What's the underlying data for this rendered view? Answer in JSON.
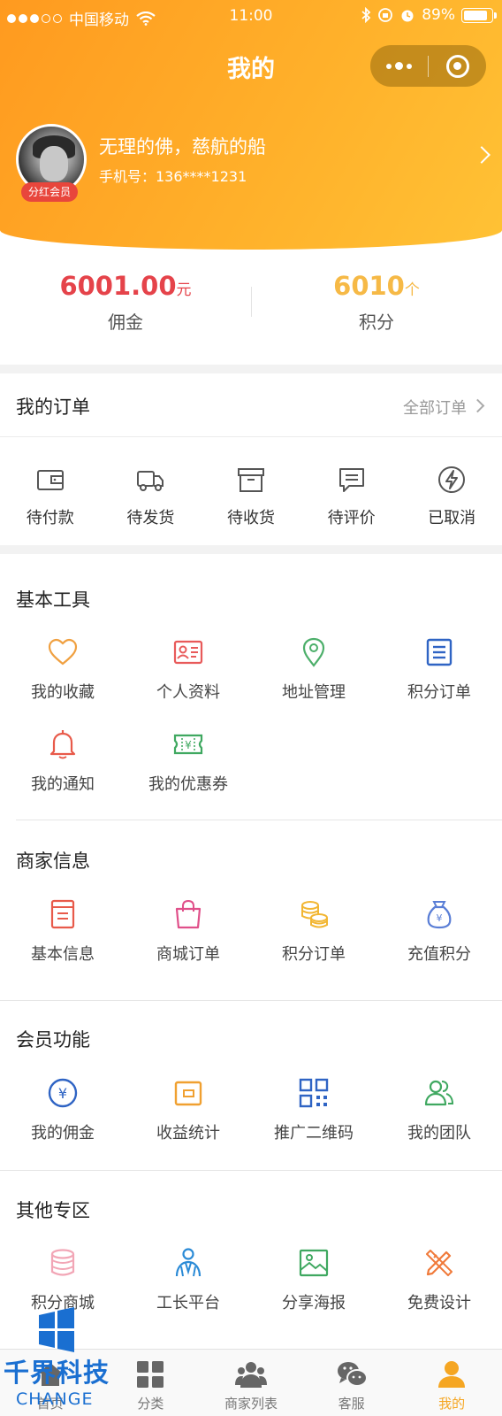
{
  "status_bar": {
    "carrier": "中国移动",
    "time": "11:00",
    "battery": "89%"
  },
  "nav": {
    "title": "我的"
  },
  "profile": {
    "name": "无理的佛，慈航的船",
    "phone": "手机号：136****1231",
    "badge": "分红会员"
  },
  "stats": {
    "commission": {
      "value": "6001.00",
      "unit": "元",
      "label": "佣金"
    },
    "points": {
      "value": "6010",
      "unit": "个",
      "label": "积分"
    }
  },
  "orders": {
    "title": "我的订单",
    "all_label": "全部订单",
    "items": [
      {
        "label": "待付款",
        "icon": "wallet-icon"
      },
      {
        "label": "待发货",
        "icon": "truck-icon"
      },
      {
        "label": "待收货",
        "icon": "box-icon"
      },
      {
        "label": "待评价",
        "icon": "comment-icon"
      },
      {
        "label": "已取消",
        "icon": "bolt-circle-icon"
      }
    ]
  },
  "sections": [
    {
      "title": "基本工具",
      "items": [
        {
          "label": "我的收藏",
          "icon": "heart-icon",
          "color": "#f0a040"
        },
        {
          "label": "个人资料",
          "icon": "id-card-icon",
          "color": "#e85a5a"
        },
        {
          "label": "地址管理",
          "icon": "location-icon",
          "color": "#4caf6a"
        },
        {
          "label": "积分订单",
          "icon": "list-icon",
          "color": "#2f64c4"
        },
        {
          "label": "我的通知",
          "icon": "bell-icon",
          "color": "#e85a4a"
        },
        {
          "label": "我的优惠券",
          "icon": "coupon-icon",
          "color": "#3fa860"
        }
      ]
    },
    {
      "title": "商家信息",
      "items": [
        {
          "label": "基本信息",
          "icon": "document-icon",
          "color": "#e85a4a"
        },
        {
          "label": "商城订单",
          "icon": "shopping-bag-icon",
          "color": "#e0508a"
        },
        {
          "label": "积分订单",
          "icon": "coins-icon",
          "color": "#f2b632"
        },
        {
          "label": "充值积分",
          "icon": "money-bag-icon",
          "color": "#5a7ed6"
        }
      ]
    },
    {
      "title": "会员功能",
      "items": [
        {
          "label": "我的佣金",
          "icon": "yen-circle-icon",
          "color": "#2f64c4"
        },
        {
          "label": "收益统计",
          "icon": "card-wallet-icon",
          "color": "#f0a030"
        },
        {
          "label": "推广二维码",
          "icon": "qr-code-icon",
          "color": "#2f64c4"
        },
        {
          "label": "我的团队",
          "icon": "team-icon",
          "color": "#3fa860"
        }
      ]
    },
    {
      "title": "其他专区",
      "items": [
        {
          "label": "积分商城",
          "icon": "database-icon",
          "color": "#f2a6b6"
        },
        {
          "label": "工长平台",
          "icon": "worker-icon",
          "color": "#2a8ad6"
        },
        {
          "label": "分享海报",
          "icon": "image-icon",
          "color": "#3fa860"
        },
        {
          "label": "免费设计",
          "icon": "design-tools-icon",
          "color": "#f07a3a"
        }
      ]
    }
  ],
  "tabbar": {
    "items": [
      {
        "label": "首页",
        "icon": "home-icon"
      },
      {
        "label": "分类",
        "icon": "grid-icon"
      },
      {
        "label": "商家列表",
        "icon": "merchants-icon"
      },
      {
        "label": "客服",
        "icon": "wechat-icon"
      },
      {
        "label": "我的",
        "icon": "person-icon"
      }
    ],
    "active_color": "#f5a623",
    "inactive_color": "#666666"
  },
  "watermark": {
    "name_cn": "千界科技",
    "name_en": "CHANGE"
  },
  "colors": {
    "header_gradient_start": "#ff9a1f",
    "header_gradient_end": "#ffc235",
    "commission": "#e5434a",
    "points": "#f6b946"
  }
}
